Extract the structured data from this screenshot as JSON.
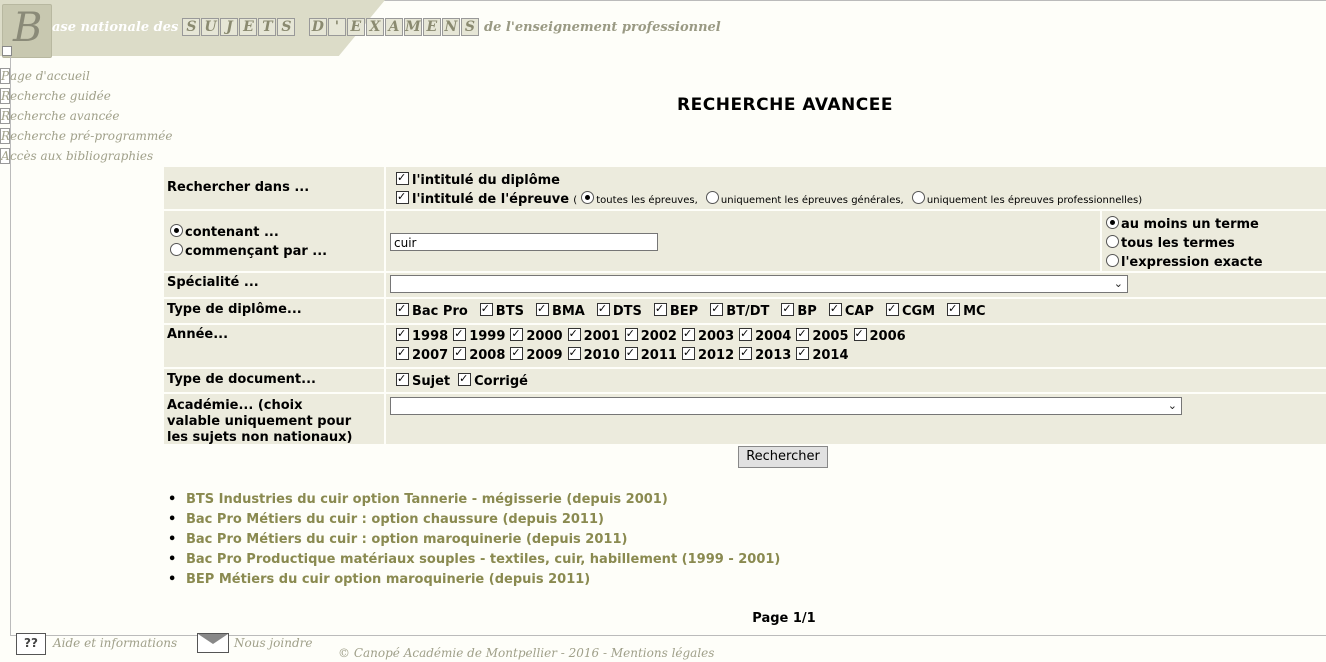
{
  "header": {
    "logo_letter": "B",
    "title_prefix": "ase nationale des",
    "word1": [
      "S",
      "U",
      "J",
      "E",
      "T",
      "S"
    ],
    "word2": [
      "D",
      "'",
      "E",
      "X",
      "A",
      "M",
      "E",
      "N",
      "S"
    ],
    "title_suffix": "de l'enseignement professionnel"
  },
  "nav": [
    {
      "initial": "P",
      "rest": "age d'accueil"
    },
    {
      "initial": "R",
      "rest": "echerche guidée"
    },
    {
      "initial": "R",
      "rest": "echerche avancée"
    },
    {
      "initial": "R",
      "rest": "echerche pré-programmée"
    },
    {
      "initial": "A",
      "rest": "ccès aux bibliographies"
    }
  ],
  "page_title": "RECHERCHE AVANCEE",
  "form": {
    "search_in": {
      "label": "Rechercher dans ...",
      "opt_diploma": "l'intitulé du diplôme",
      "opt_exam": "l'intitulé de l'épreuve",
      "paren_open": "(",
      "scope_all": "toutes les épreuves,",
      "scope_general": "uniquement les épreuves générales,",
      "scope_professional": "uniquement les épreuves professionnelles)"
    },
    "match": {
      "containing": "contenant ...",
      "starting": "commençant par ...",
      "query_value": "cuir",
      "any_term": "au moins un terme",
      "all_terms": "tous les termes",
      "exact": "l'expression exacte"
    },
    "speciality": {
      "label": "Spécialité ...",
      "selected": ""
    },
    "diploma_type": {
      "label": "Type de diplôme...",
      "options": [
        "Bac Pro",
        "BTS",
        "BMA",
        "DTS",
        "BEP",
        "BT/DT",
        "BP",
        "CAP",
        "CGM",
        "MC"
      ]
    },
    "year": {
      "label": "Année...",
      "row1": [
        "1998",
        "1999",
        "2000",
        "2001",
        "2002",
        "2003",
        "2004",
        "2005",
        "2006"
      ],
      "row2": [
        "2007",
        "2008",
        "2009",
        "2010",
        "2011",
        "2012",
        "2013",
        "2014"
      ]
    },
    "doc_type": {
      "label": "Type de document...",
      "options": [
        "Sujet",
        "Corrigé"
      ]
    },
    "academy": {
      "label": "Académie... (choix valable uniquement pour les sujets non nationaux)",
      "selected": ""
    },
    "submit_label": "Rechercher"
  },
  "results": [
    "BTS Industries du cuir option Tannerie - mégisserie (depuis 2001)",
    "Bac Pro Métiers du cuir : option chaussure (depuis 2011)",
    "Bac Pro Métiers du cuir : option maroquinerie (depuis 2011)",
    "Bac Pro Productique matériaux souples - textiles, cuir, habillement (1999 - 2001)",
    "BEP Métiers du cuir option maroquinerie (depuis 2011)"
  ],
  "pager": "Page 1/1",
  "footer": {
    "help_label": "Aide et informations",
    "contact_label": "Nous joindre",
    "copyright": "© Canopé Académie de Montpellier - 2016 - Mentions légales"
  },
  "colors": {
    "accent": "#8a8a50",
    "row_bg": "#ecebdd",
    "header_bg": "#dcdcc8"
  }
}
